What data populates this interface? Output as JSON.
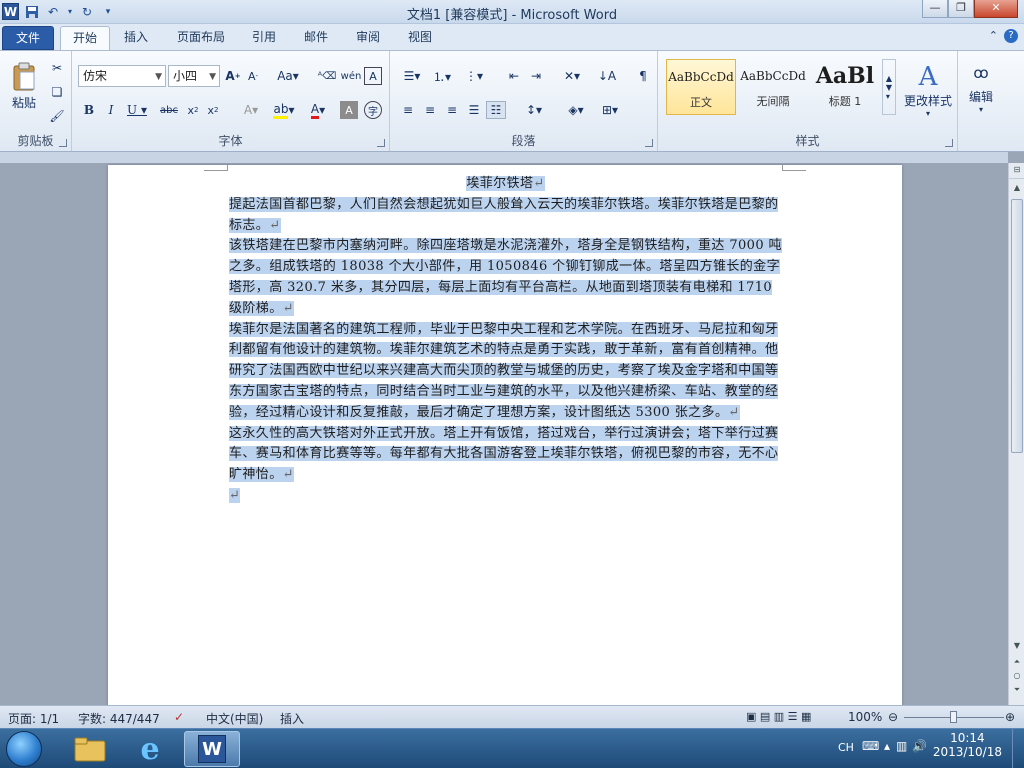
{
  "window": {
    "title": "文档1 [兼容模式] - Microsoft Word"
  },
  "tabs": {
    "file": "文件",
    "items": [
      "开始",
      "插入",
      "页面布局",
      "引用",
      "邮件",
      "审阅",
      "视图"
    ]
  },
  "ribbon": {
    "clipboard": {
      "label": "剪贴板",
      "paste": "粘贴"
    },
    "font": {
      "label": "字体",
      "name": "仿宋",
      "size": "小四"
    },
    "paragraph": {
      "label": "段落"
    },
    "styles": {
      "label": "样式",
      "items": [
        {
          "preview": "AaBbCcDd",
          "name": "正文"
        },
        {
          "preview": "AaBbCcDd",
          "name": "无间隔"
        },
        {
          "preview": "AaBl",
          "name": "标题 1"
        }
      ],
      "change": "更改样式"
    },
    "editing": {
      "label": "编辑"
    }
  },
  "document": {
    "title": "埃菲尔铁塔",
    "paragraphs": [
      "提起法国首都巴黎，人们自然会想起犹如巨人般耸入云天的埃菲尔铁塔。埃菲尔铁塔是巴黎的标志。",
      "该铁塔建在巴黎市内塞纳河畔。除四座塔墩是水泥浇灌外，塔身全是钢铁结构，重达 7000 吨之多。组成铁塔的 18038 个大小部件，用 1050846 个铆钉铆成一体。塔呈四方锥长的金字塔形，高 320.7 米多，其分四层，每层上面均有平台高栏。从地面到塔顶装有电梯和 1710 级阶梯。",
      "埃菲尔是法国著名的建筑工程师，毕业于巴黎中央工程和艺术学院。在西班牙、马尼拉和匈牙利都留有他设计的建筑物。埃菲尔建筑艺术的特点是勇于实践，敢于革新，富有首创精神。他研究了法国西欧中世纪以来兴建高大而尖顶的教堂与城堡的历史，考察了埃及金字塔和中国等东方国家古宝塔的特点，同时结合当时工业与建筑的水平，以及他兴建桥梁、车站、教堂的经验，经过精心设计和反复推敲，最后才确定了理想方案，设计图纸达 5300 张之多。",
      "这永久性的高大铁塔对外正式开放。塔上开有饭馆，搭过戏台，举行过演讲会；塔下举行过赛车、赛马和体育比赛等等。每年都有大批各国游客登上埃菲尔铁塔，俯视巴黎的市容，无不心旷神怡。"
    ],
    "mark": "↵"
  },
  "status": {
    "page": "页面: 1/1",
    "words": "字数: 447/447",
    "lang": "中文(中国)",
    "mode": "插入",
    "zoom": "100%"
  },
  "taskbar": {
    "lang": "CH",
    "time": "10:14",
    "date": "2013/10/18"
  }
}
